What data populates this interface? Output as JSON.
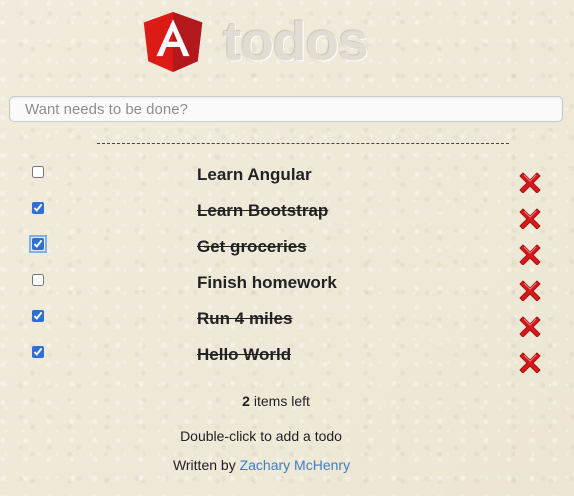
{
  "header": {
    "logo_icon": "angular-shield-icon",
    "title": "todos"
  },
  "new_todo": {
    "placeholder": "Want needs to be done?",
    "value": ""
  },
  "todos": [
    {
      "text": "Learn Angular",
      "done": false,
      "delete_icon": "red-x-icon"
    },
    {
      "text": "Learn Bootstrap",
      "done": true,
      "delete_icon": "red-x-icon"
    },
    {
      "text": "Get groceries",
      "done": true,
      "delete_icon": "red-x-icon"
    },
    {
      "text": "Finish homework",
      "done": false,
      "delete_icon": "red-x-icon"
    },
    {
      "text": "Run 4 miles",
      "done": true,
      "delete_icon": "red-x-icon"
    },
    {
      "text": "Hello World",
      "done": true,
      "delete_icon": "red-x-icon"
    }
  ],
  "footer": {
    "items_left_count": "2",
    "items_left_label": "items left",
    "hint": "Double-click to add a todo",
    "credit_prefix": "Written by",
    "credit_link": "Zachary McHenry"
  },
  "colors": {
    "background": "#efe9d8",
    "angular_red": "#dd1b16",
    "angular_dark_red": "#b3181c",
    "delete_red": "#d7191a",
    "link_blue": "#3e7fc1"
  }
}
